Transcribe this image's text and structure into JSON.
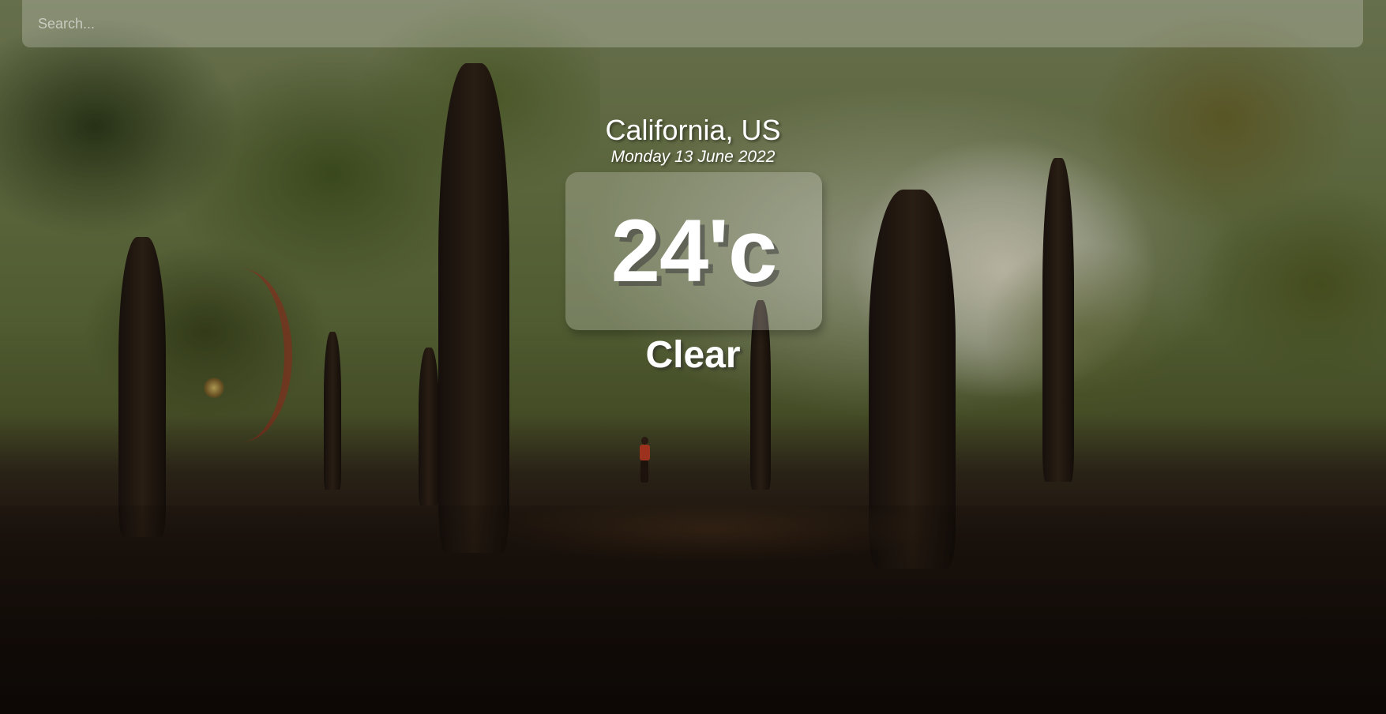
{
  "search": {
    "placeholder": "Search...",
    "value": ""
  },
  "weather": {
    "location": "California, US",
    "date": "Monday 13 June 2022",
    "temperature": "24'c",
    "condition": "Clear"
  },
  "colors": {
    "text": "#ffffff",
    "panel": "rgba(255,255,255,0.22)"
  }
}
